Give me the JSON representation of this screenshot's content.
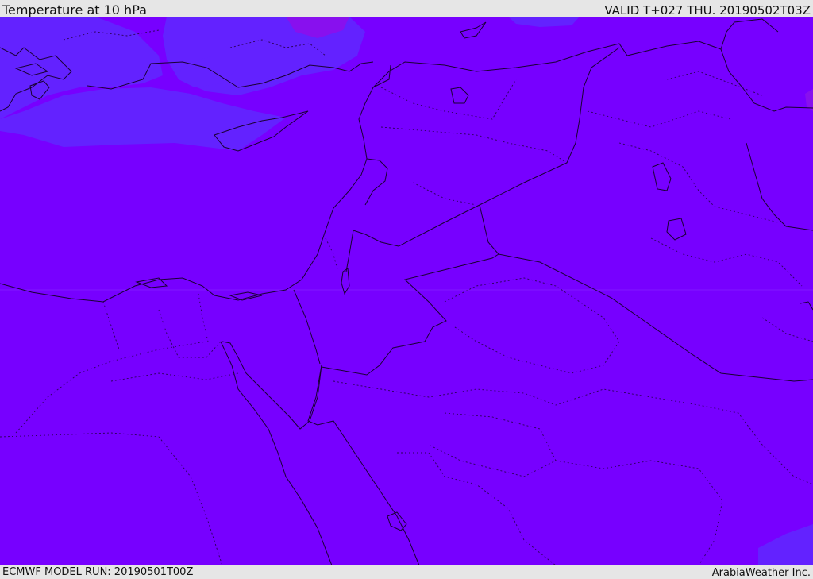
{
  "header": {
    "title": "Temperature at 10 hPa",
    "valid_time": "VALID T+027 THU. 20190502T03Z"
  },
  "footer": {
    "model_run": "ECMWF MODEL RUN: 20190501T00Z",
    "brand": "ArabiaWeather Inc."
  },
  "map": {
    "field_color": "#7700ff",
    "cool_patch_color": "#6322ff",
    "warm_patch_color": "#8810ee",
    "line_color": "#1a0033"
  }
}
